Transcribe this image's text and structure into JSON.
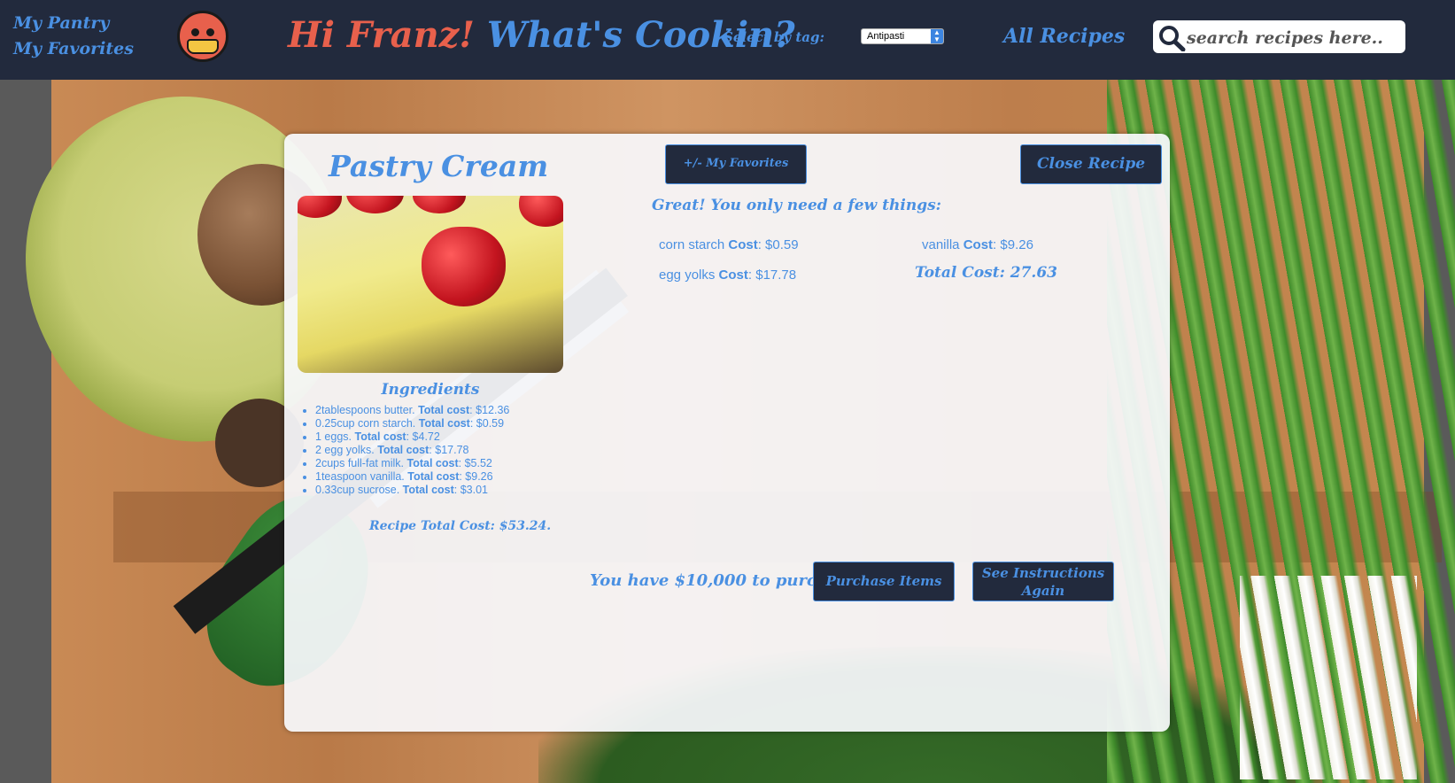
{
  "header": {
    "nav": [
      "My Pantry",
      "My Favorites"
    ],
    "avatar_icon": "masked-tomato-face-icon",
    "greeting_name": "Hi Franz!",
    "greeting_rest": " What's Cookin?",
    "tag_label": "Select by tag:",
    "tag_selected": "Antipasti",
    "all_recipes": "All Recipes",
    "search_placeholder": "search recipes here..",
    "search_icon": "magnifier-icon"
  },
  "recipe": {
    "title": "Pastry Cream",
    "favorites_button": "+/- My Favorites",
    "close_button": "Close Recipe",
    "ingredients_heading": "Ingredients",
    "ingredients": [
      {
        "text": "2tablespoons butter. ",
        "label": "Total cost",
        "cost": ": $12.36"
      },
      {
        "text": "0.25cup corn starch. ",
        "label": "Total cost",
        "cost": ": $0.59"
      },
      {
        "text": "1 eggs. ",
        "label": "Total cost",
        "cost": ": $4.72"
      },
      {
        "text": "2 egg yolks. ",
        "label": "Total cost",
        "cost": ": $17.78"
      },
      {
        "text": "2cups full-fat milk. ",
        "label": "Total cost",
        "cost": ": $5.52"
      },
      {
        "text": "1teaspoon vanilla. ",
        "label": "Total cost",
        "cost": ": $9.26"
      },
      {
        "text": "0.33cup sucrose. ",
        "label": "Total cost",
        "cost": ": $3.01"
      }
    ],
    "recipe_total": "Recipe Total Cost: $53.24.",
    "need_heading": "Great! You only need a few things:",
    "needed": [
      {
        "name": "corn starch ",
        "label": "Cost",
        "cost": ": $0.59"
      },
      {
        "name": "egg yolks ",
        "label": "Cost",
        "cost": ": $17.78"
      },
      {
        "name": "vanilla ",
        "label": "Cost",
        "cost": ": $9.26"
      }
    ],
    "needed_total": "Total Cost: 27.63",
    "budget_text": "You have $10,000 to purchase.",
    "purchase_button": "Purchase Items",
    "instructions_button": "See Instructions Again"
  },
  "colors": {
    "header_bg": "#222a3d",
    "accent_blue": "#4a90e2",
    "accent_red": "#e8604c"
  }
}
